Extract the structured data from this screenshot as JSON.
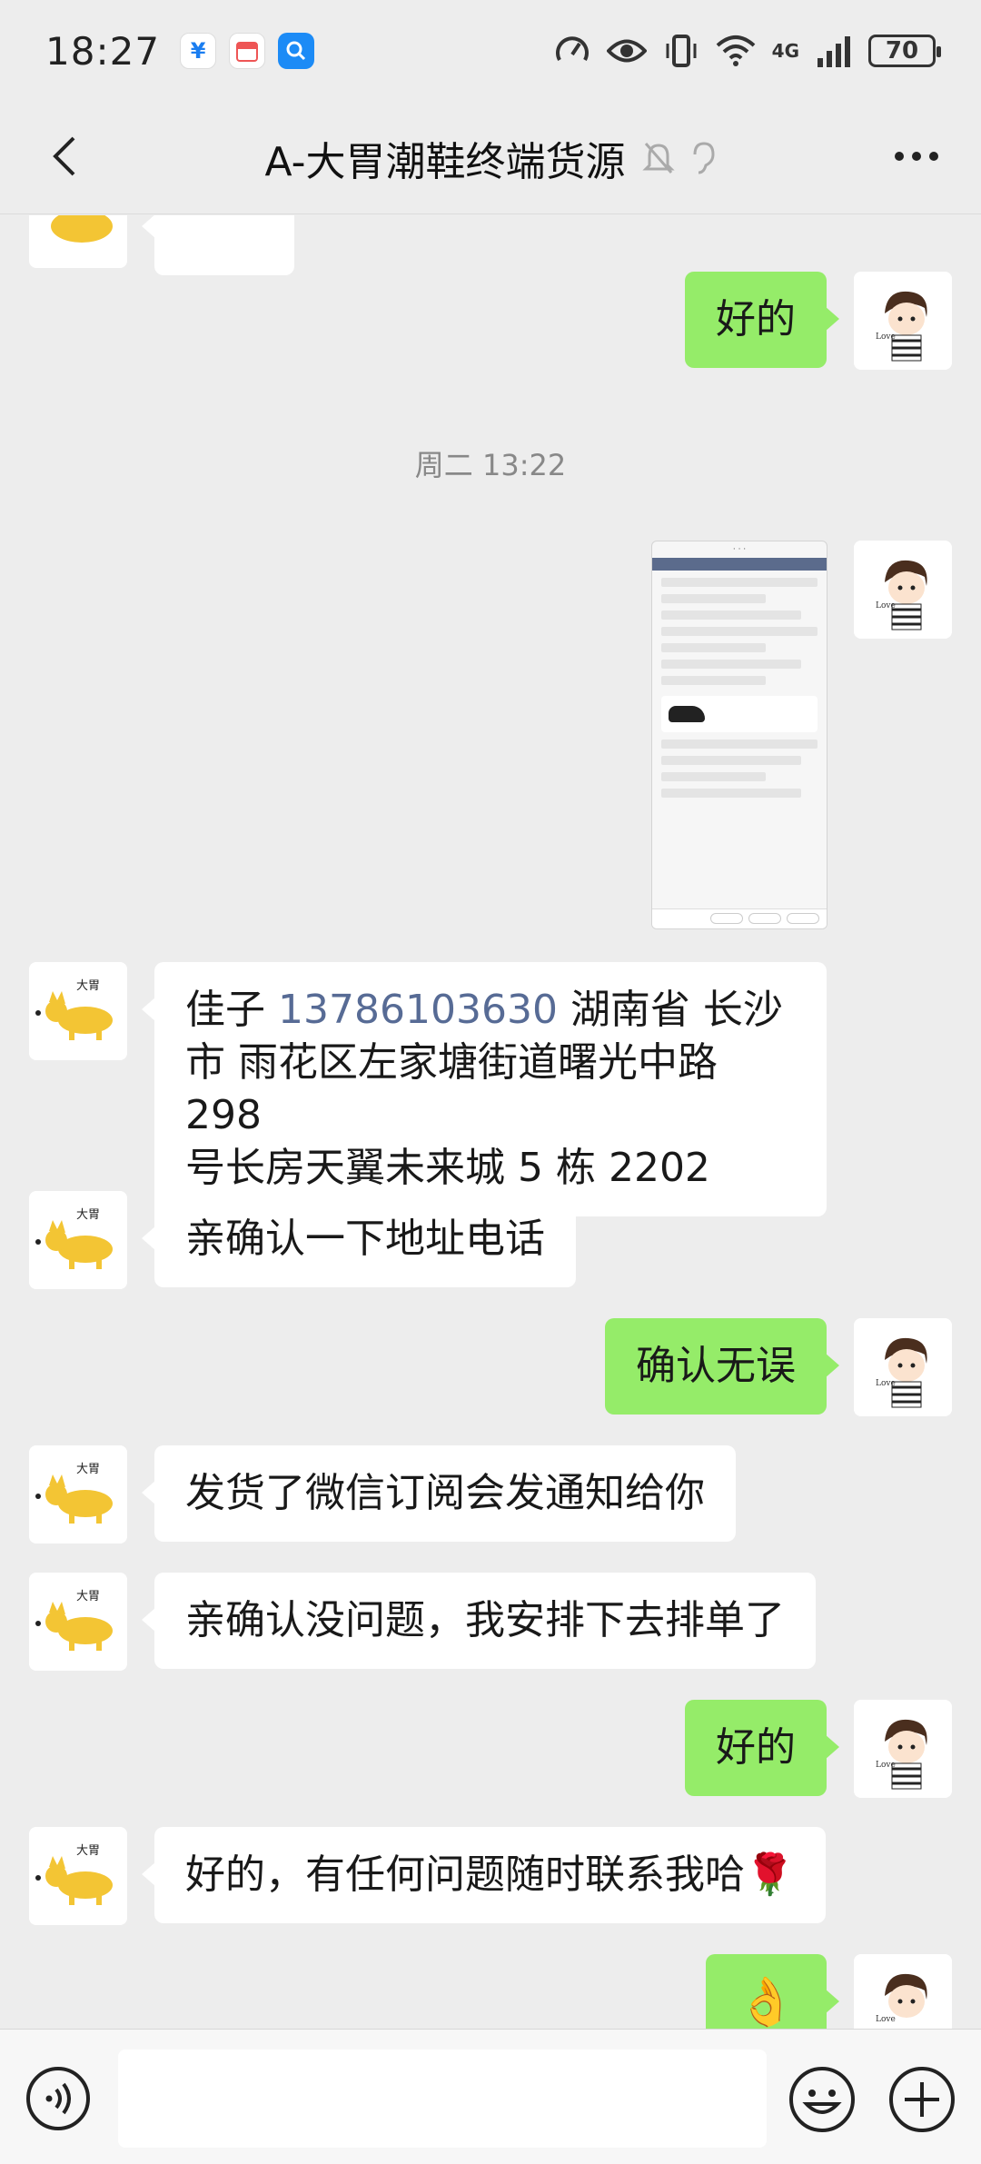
{
  "status_bar": {
    "time": "18:27",
    "network": "4G",
    "battery": "70"
  },
  "header": {
    "title": "A-大胃潮鞋终端货源"
  },
  "messages": {
    "m1": "好的",
    "timestamp1": "周二 13:22",
    "m3_name": "佳子",
    "m3_phone": "13786103630",
    "m3_line1_rest": "湖南省 长沙",
    "m3_line2": "市 雨花区左家塘街道曙光中路 298",
    "m3_line3": "号长房天翼未来城 5 栋 2202",
    "m4": "亲确认一下地址电话",
    "m5": "确认无误",
    "m6": "发货了微信订阅会发通知给你",
    "m7": "亲确认没问题，我安排下去排单了",
    "m8": "好的",
    "m9": "好的，有任何问题随时联系我哈🌹",
    "m10": "👌"
  },
  "avatar_texts": {
    "dog_caption": "大胃",
    "boy_caption": "Love"
  },
  "colors": {
    "background": "#ededed",
    "my_bubble": "#95ec69",
    "their_bubble": "#ffffff",
    "link": "#576b95"
  }
}
